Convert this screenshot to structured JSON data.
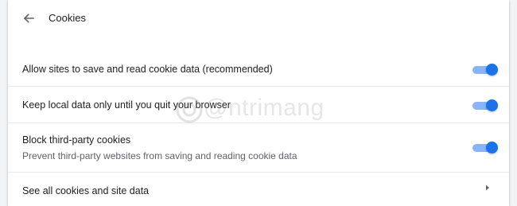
{
  "header": {
    "title": "Cookies",
    "back_icon": "arrow-back-icon"
  },
  "settings": [
    {
      "label": "Allow sites to save and read cookie data (recommended)",
      "enabled": true
    },
    {
      "label": "Keep local data only until you quit your browser",
      "enabled": true
    },
    {
      "label": "Block third-party cookies",
      "sublabel": "Prevent third-party websites from saving and reading cookie data",
      "enabled": true
    }
  ],
  "link_row": {
    "label": "See all cookies and site data",
    "icon": "chevron-right-icon"
  },
  "watermark": {
    "text": "@ntrimang"
  },
  "colors": {
    "accent": "#1a73e8",
    "accent_track": "#8ab4f8",
    "text_primary": "#202124",
    "text_secondary": "#5f6368",
    "divider": "#e8eaed",
    "page_bg": "#f1f3f4",
    "card_bg": "#ffffff"
  }
}
